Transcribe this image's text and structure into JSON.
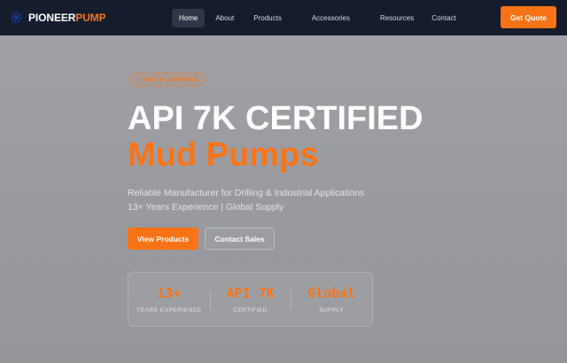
{
  "brand": {
    "name_part1": "PIONEER",
    "name_part2": "PUMP",
    "icon": "gear-icon",
    "accent_color": "#f97316"
  },
  "nav": {
    "items": [
      {
        "label": "Home",
        "active": true
      },
      {
        "label": "About"
      },
      {
        "label": "Products"
      },
      {
        "label": "Accessories"
      },
      {
        "label": "Resources"
      },
      {
        "label": "Contact"
      }
    ],
    "cta_label": "Get Quote"
  },
  "hero": {
    "badge": "API 7K CERTIFIED",
    "badge_icon": "check-icon",
    "title_line1": "API 7K CERTIFIED",
    "title_line2": "Mud Pumps",
    "subtitle_line1": "Reliable Manufacturer for Drilling & Industrial Applications",
    "subtitle_line2": "13+ Years Experience | Global Supply",
    "primary_button": "View Products",
    "secondary_button": "Contact Sales"
  },
  "stats": [
    {
      "value": "13+",
      "label": "YEARS EXPERIENCE"
    },
    {
      "value": "API 7K",
      "label": "CERTIFIED"
    },
    {
      "value": "Global",
      "label": "SUPPLY"
    }
  ]
}
